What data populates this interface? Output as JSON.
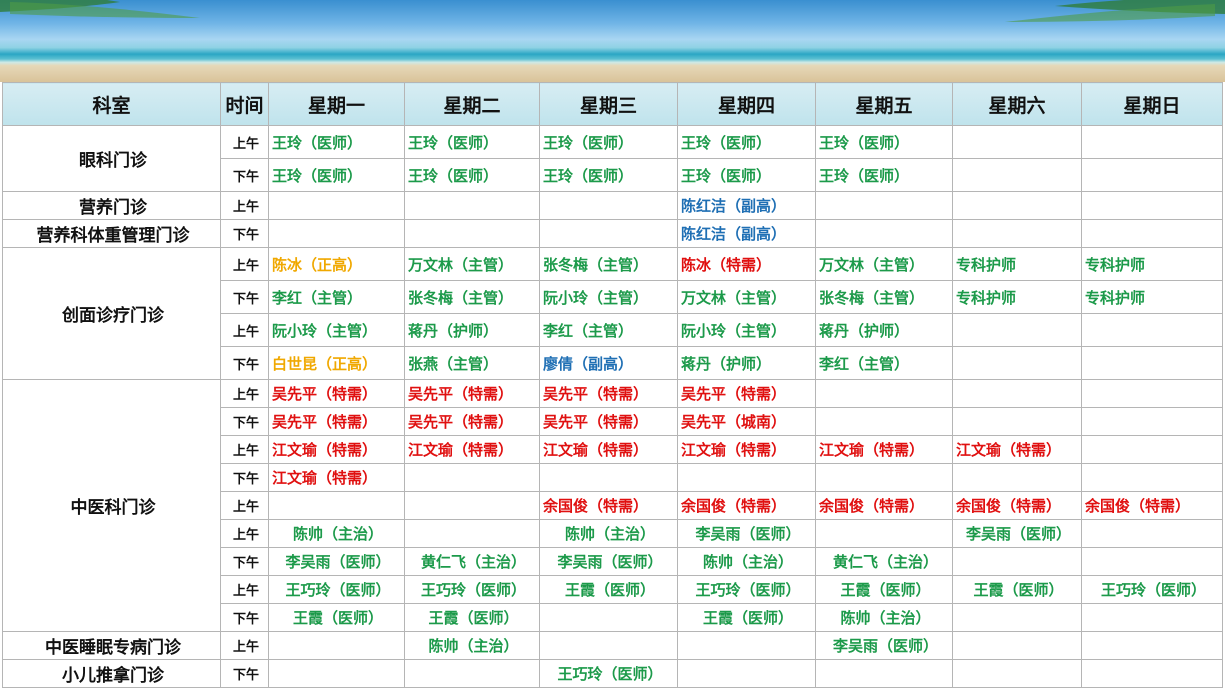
{
  "header": {
    "dept": "科室",
    "time": "时间",
    "days": [
      "星期一",
      "星期二",
      "星期三",
      "星期四",
      "星期五",
      "星期六",
      "星期日"
    ]
  },
  "colors": {
    "green": "#1c9a4a",
    "red": "#e01010",
    "blue": "#1f6fb4",
    "orange": "#f0a800"
  },
  "rows": [
    {
      "dept": "眼科门诊",
      "span": 2,
      "time": "上午",
      "cells": [
        [
          "王玲（医师）",
          "g"
        ],
        [
          "王玲（医师）",
          "g"
        ],
        [
          "王玲（医师）",
          "g"
        ],
        [
          "王玲（医师）",
          "g"
        ],
        [
          "王玲（医师）",
          "g"
        ],
        [
          "",
          ""
        ],
        [
          "",
          ""
        ]
      ]
    },
    {
      "time": "下午",
      "cells": [
        [
          "王玲（医师）",
          "g"
        ],
        [
          "王玲（医师）",
          "g"
        ],
        [
          "王玲（医师）",
          "g"
        ],
        [
          "王玲（医师）",
          "g"
        ],
        [
          "王玲（医师）",
          "g"
        ],
        [
          "",
          ""
        ],
        [
          "",
          ""
        ]
      ]
    },
    {
      "dept": "营养门诊",
      "span": 1,
      "time": "上午",
      "cells": [
        [
          "",
          ""
        ],
        [
          "",
          ""
        ],
        [
          "",
          ""
        ],
        [
          "陈红洁（副高）",
          "b"
        ],
        [
          "",
          ""
        ],
        [
          "",
          ""
        ],
        [
          "",
          ""
        ]
      ]
    },
    {
      "dept": "营养科体重管理门诊",
      "span": 1,
      "time": "下午",
      "cells": [
        [
          "",
          ""
        ],
        [
          "",
          ""
        ],
        [
          "",
          ""
        ],
        [
          "陈红洁（副高）",
          "b"
        ],
        [
          "",
          ""
        ],
        [
          "",
          ""
        ],
        [
          "",
          ""
        ]
      ]
    },
    {
      "dept": "创面诊疗门诊",
      "span": 4,
      "time": "上午",
      "cells": [
        [
          "陈冰（正高）",
          "o"
        ],
        [
          "万文林（主管）",
          "g"
        ],
        [
          "张冬梅（主管）",
          "g"
        ],
        [
          "陈冰（特需）",
          "r"
        ],
        [
          "万文林（主管）",
          "g"
        ],
        [
          "专科护师",
          "g"
        ],
        [
          "专科护师",
          "g"
        ]
      ]
    },
    {
      "time": "下午",
      "cells": [
        [
          "李红（主管）",
          "g"
        ],
        [
          "张冬梅（主管）",
          "g"
        ],
        [
          "阮小玲（主管）",
          "g"
        ],
        [
          "万文林（主管）",
          "g"
        ],
        [
          "张冬梅（主管）",
          "g"
        ],
        [
          "专科护师",
          "g"
        ],
        [
          "专科护师",
          "g"
        ]
      ]
    },
    {
      "time": "上午",
      "cells": [
        [
          "阮小玲（主管）",
          "g"
        ],
        [
          "蒋丹（护师）",
          "g"
        ],
        [
          "李红（主管）",
          "g"
        ],
        [
          "阮小玲（主管）",
          "g"
        ],
        [
          "蒋丹（护师）",
          "g"
        ],
        [
          "",
          ""
        ],
        [
          "",
          ""
        ]
      ]
    },
    {
      "time": "下午",
      "cells": [
        [
          "白世昆（正高）",
          "o"
        ],
        [
          "张燕（主管）",
          "g"
        ],
        [
          "廖倩（副高）",
          "b"
        ],
        [
          "蒋丹（护师）",
          "g"
        ],
        [
          "李红（主管）",
          "g"
        ],
        [
          "",
          ""
        ],
        [
          "",
          ""
        ]
      ]
    },
    {
      "dept": "中医科门诊",
      "span": 9,
      "time": "上午",
      "cells": [
        [
          "吴先平（特需）",
          "r"
        ],
        [
          "吴先平（特需）",
          "r"
        ],
        [
          "吴先平（特需）",
          "r"
        ],
        [
          "吴先平（特需）",
          "r"
        ],
        [
          "",
          ""
        ],
        [
          "",
          ""
        ],
        [
          "",
          ""
        ]
      ]
    },
    {
      "time": "下午",
      "cells": [
        [
          "吴先平（特需）",
          "r"
        ],
        [
          "吴先平（特需）",
          "r"
        ],
        [
          "吴先平（特需）",
          "r"
        ],
        [
          "吴先平（城南）",
          "r"
        ],
        [
          "",
          ""
        ],
        [
          "",
          ""
        ],
        [
          "",
          ""
        ]
      ]
    },
    {
      "time": "上午",
      "cells": [
        [
          "江文瑜（特需）",
          "r"
        ],
        [
          "江文瑜（特需）",
          "r"
        ],
        [
          "江文瑜（特需）",
          "r"
        ],
        [
          "江文瑜（特需）",
          "r"
        ],
        [
          "江文瑜（特需）",
          "r"
        ],
        [
          "江文瑜（特需）",
          "r"
        ],
        [
          "",
          ""
        ]
      ]
    },
    {
      "time": "下午",
      "cells": [
        [
          "江文瑜（特需）",
          "r"
        ],
        [
          "",
          ""
        ],
        [
          "",
          ""
        ],
        [
          "",
          ""
        ],
        [
          "",
          ""
        ],
        [
          "",
          ""
        ],
        [
          "",
          ""
        ]
      ]
    },
    {
      "time": "上午",
      "cells": [
        [
          "",
          ""
        ],
        [
          "",
          ""
        ],
        [
          "余国俊（特需）",
          "r"
        ],
        [
          "余国俊（特需）",
          "r"
        ],
        [
          "余国俊（特需）",
          "r"
        ],
        [
          "余国俊（特需）",
          "r"
        ],
        [
          "余国俊（特需）",
          "r"
        ]
      ]
    },
    {
      "time": "上午",
      "center": true,
      "cells": [
        [
          "陈帅（主治）",
          "g"
        ],
        [
          "",
          ""
        ],
        [
          "陈帅（主治）",
          "g"
        ],
        [
          "李吴雨（医师）",
          "g"
        ],
        [
          "",
          ""
        ],
        [
          "李吴雨（医师）",
          "g"
        ],
        [
          "",
          ""
        ]
      ]
    },
    {
      "time": "下午",
      "center": true,
      "cells": [
        [
          "李吴雨（医师）",
          "g"
        ],
        [
          "黄仁飞（主治）",
          "g"
        ],
        [
          "李吴雨（医师）",
          "g"
        ],
        [
          "陈帅（主治）",
          "g"
        ],
        [
          "黄仁飞（主治）",
          "g"
        ],
        [
          "",
          ""
        ],
        [
          "",
          ""
        ]
      ]
    },
    {
      "time": "上午",
      "center": true,
      "cells": [
        [
          "王巧玲（医师）",
          "g"
        ],
        [
          "王巧玲（医师）",
          "g"
        ],
        [
          "王霞（医师）",
          "g"
        ],
        [
          "王巧玲（医师）",
          "g"
        ],
        [
          "王霞（医师）",
          "g"
        ],
        [
          "王霞（医师）",
          "g"
        ],
        [
          "王巧玲（医师）",
          "g"
        ]
      ]
    },
    {
      "time": "下午",
      "center": true,
      "cells": [
        [
          "王霞（医师）",
          "g"
        ],
        [
          "王霞（医师）",
          "g"
        ],
        [
          "",
          ""
        ],
        [
          "王霞（医师）",
          "g"
        ],
        [
          "陈帅（主治）",
          "g"
        ],
        [
          "",
          ""
        ],
        [
          "",
          ""
        ]
      ]
    },
    {
      "dept": "中医睡眠专病门诊",
      "span": 1,
      "time": "上午",
      "center": true,
      "cells": [
        [
          "",
          ""
        ],
        [
          "陈帅（主治）",
          "g"
        ],
        [
          "",
          ""
        ],
        [
          "",
          ""
        ],
        [
          "李吴雨（医师）",
          "g"
        ],
        [
          "",
          ""
        ],
        [
          "",
          ""
        ]
      ]
    },
    {
      "dept": "小儿推拿门诊",
      "span": 1,
      "time": "下午",
      "center": true,
      "cells": [
        [
          "",
          ""
        ],
        [
          "",
          ""
        ],
        [
          "王巧玲（医师）",
          "g"
        ],
        [
          "",
          ""
        ],
        [
          "",
          ""
        ],
        [
          "",
          ""
        ],
        [
          "",
          ""
        ]
      ]
    }
  ]
}
